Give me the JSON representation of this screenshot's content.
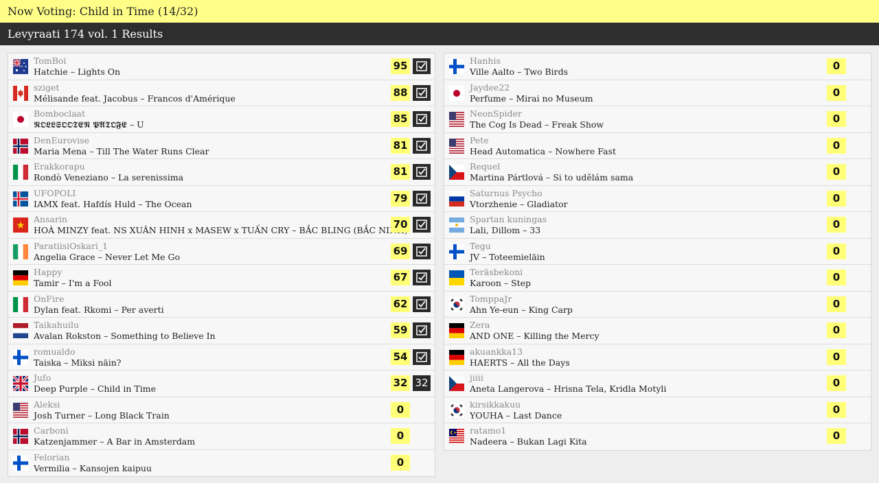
{
  "header": {
    "now_voting": "Now Voting: Child in Time (14/32)",
    "results_title": "Levyraati 174 vol. 1 Results"
  },
  "left": [
    {
      "flag": "australia",
      "user": "TomBoi",
      "song": "Hatchie – Lights On",
      "score": "95",
      "given": "check"
    },
    {
      "flag": "canada",
      "user": "sziget",
      "song": "Mélisande feat. Jacobus – Francos d'Amérique",
      "score": "88",
      "given": "check"
    },
    {
      "flag": "japan",
      "user": "Bomboclaat",
      "song": "𝕹𝕺𝕷𝕷𝕾𝕺𝕺𝕿𝕰𝕹 𝕻𝕬𝕿𝕺𝕱𝕰 – U",
      "score": "85",
      "given": "check"
    },
    {
      "flag": "norway",
      "user": "DenEurovise",
      "song": "Maria Mena – Till The Water Runs Clear",
      "score": "81",
      "given": "check"
    },
    {
      "flag": "italy",
      "user": "Erakkorapu",
      "song": "Rondò Veneziano – La serenissima",
      "score": "81",
      "given": "check"
    },
    {
      "flag": "iceland",
      "user": "UFOPOLI",
      "song": "IAMX feat. Hafdís Huld – The Ocean",
      "score": "79",
      "given": "check"
    },
    {
      "flag": "vietnam",
      "user": "Ansarin",
      "song": "HOÀ MINZY feat. NS XUÂN HINH x MASEW x TUẤN CRY – BẮC BLING (BẮC NINH)",
      "score": "70",
      "given": "check"
    },
    {
      "flag": "ireland",
      "user": "ParatiisiOskari_1",
      "song": "Angelia Grace – Never Let Me Go",
      "score": "69",
      "given": "check"
    },
    {
      "flag": "germany",
      "user": "Happy",
      "song": "Tamir – I'm a Fool",
      "score": "67",
      "given": "check"
    },
    {
      "flag": "italy",
      "user": "OnFire",
      "song": "Dylan feat. Rkomi – Per averti",
      "score": "62",
      "given": "check"
    },
    {
      "flag": "netherlands",
      "user": "Taikahuilu",
      "song": "Avalan Rokston – Something to Believe In",
      "score": "59",
      "given": "check"
    },
    {
      "flag": "finland",
      "user": "romualdo",
      "song": "Taiska – Miksi näin?",
      "score": "54",
      "given": "check"
    },
    {
      "flag": "uk",
      "user": "Jufo",
      "song": "Deep Purple – Child in Time",
      "score": "32",
      "given": "32"
    },
    {
      "flag": "usa",
      "user": "Aleksi",
      "song": "Josh Turner – Long Black Train",
      "score": "0",
      "given": ""
    },
    {
      "flag": "norway",
      "user": "Carboni",
      "song": "Katzenjammer – A Bar in Amsterdam",
      "score": "0",
      "given": ""
    },
    {
      "flag": "finland",
      "user": "Felorian",
      "song": "Vermilia – Kansojen kaipuu",
      "score": "0",
      "given": ""
    }
  ],
  "right": [
    {
      "flag": "finland",
      "user": "Hanhis",
      "song": "Ville Aalto – Two Birds",
      "score": "0"
    },
    {
      "flag": "japan",
      "user": "Jaydee22",
      "song": "Perfume – Mirai no Museum",
      "score": "0"
    },
    {
      "flag": "usa",
      "user": "NeonSpider",
      "song": "The Cog Is Dead – Freak Show",
      "score": "0"
    },
    {
      "flag": "usa",
      "user": "Pete",
      "song": "Head Automatica – Nowhere Fast",
      "score": "0"
    },
    {
      "flag": "czech",
      "user": "Requel",
      "song": "Martina Pártlová – Si to udělám sama",
      "score": "0"
    },
    {
      "flag": "russia",
      "user": "Saturnus Psycho",
      "song": "Vtorzhenie – Gladiator",
      "score": "0"
    },
    {
      "flag": "argentina",
      "user": "Spartan kuningas",
      "song": "Lali, Dillom – 33",
      "score": "0"
    },
    {
      "flag": "finland",
      "user": "Tegu",
      "song": "JV – Toteemieläin",
      "score": "0"
    },
    {
      "flag": "ukraine",
      "user": "Teräsbekoni",
      "song": "Karoon – Step",
      "score": "0"
    },
    {
      "flag": "korea",
      "user": "TomppaJr",
      "song": "Ahn Ye-eun – King Carp",
      "score": "0"
    },
    {
      "flag": "germany",
      "user": "Zera",
      "song": "AND ONE – Killing the Mercy",
      "score": "0"
    },
    {
      "flag": "germany",
      "user": "akuankka13",
      "song": "HAERTS – All the Days",
      "score": "0"
    },
    {
      "flag": "czech",
      "user": "jiiii",
      "song": "Aneta Langerova – Hrisna Tela, Kridla Motyli",
      "score": "0"
    },
    {
      "flag": "korea",
      "user": "kirsikkakuu",
      "song": "YOUHA – Last Dance",
      "score": "0"
    },
    {
      "flag": "malaysia",
      "user": "ratamo1",
      "song": "Nadeera – Bukan Lagi Kita",
      "score": "0"
    }
  ]
}
